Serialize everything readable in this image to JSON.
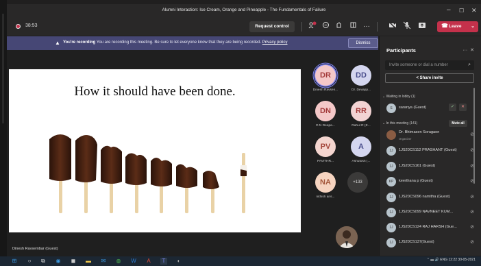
{
  "window": {
    "title": "Alumni Interaction: Ice Cream, Orange and Pineapple - The Fundamentals of Failure"
  },
  "toolbar": {
    "timer": "38:53",
    "request_control": "Request control",
    "leave": "Leave"
  },
  "banner": {
    "bold": "You're recording",
    "text": "You are recording this meeting. Be sure to let everyone know that they are being recorded.",
    "link": "Privacy policy",
    "dismiss": "Dismiss"
  },
  "slide": {
    "title": "How it should have been done.",
    "presenter": "Dinesh Ravsembar (Guest)"
  },
  "grid": {
    "tiles": [
      {
        "initials": "DR",
        "name": "Dinesh Ravsen...",
        "bg": "#f4c8c8",
        "fg": "#a33a3a",
        "active": true
      },
      {
        "initials": "DD",
        "name": "Dr. Devapp...",
        "bg": "#d4d6ef",
        "fg": "#4a4e8c",
        "active": false
      },
      {
        "initials": "DN",
        "name": "D N Deepa...",
        "bg": "#f4c8c8",
        "fg": "#a33a3a",
        "active": false
      },
      {
        "initials": "RR",
        "name": "Rahul R (E...",
        "bg": "#f2d3d3",
        "fg": "#a33a3a",
        "active": false
      },
      {
        "initials": "PV",
        "name": "PAVITHR...",
        "bg": "#f4d5cf",
        "fg": "#a3453a",
        "active": false
      },
      {
        "initials": "A",
        "name": "Ashutosh (...",
        "bg": "#d4d6ef",
        "fg": "#4a4e8c",
        "active": false
      },
      {
        "initials": "NA",
        "name": "nithish ans...",
        "bg": "#f6d4c0",
        "fg": "#a3563a",
        "active": false
      }
    ],
    "more": "+133"
  },
  "panel": {
    "title": "Participants",
    "invite_placeholder": "Invite someone or dial a number",
    "share_invite": "Share invite",
    "lobby_header": "Waiting in lobby (1)",
    "lobby": [
      {
        "name": "saranya (Guest)",
        "initial": "S"
      }
    ],
    "meeting_header": "In this meeting (141)",
    "mute_all": "Mute all",
    "people": [
      {
        "name": "Dr. Bhimasen Soragaon",
        "role": "Organizer",
        "initial": "",
        "photo": true
      },
      {
        "name": "1JS20CS112 PRASHANT (Guest)",
        "role": "",
        "initial": "1J",
        "photo": false
      },
      {
        "name": "1JS20CS161 (Guest)",
        "role": "",
        "initial": "1J",
        "photo": false
      },
      {
        "name": "keerthana p (Guest)",
        "role": "",
        "initial": "KP",
        "photo": false
      },
      {
        "name": "1JS20CS096 namitha (Guest)",
        "role": "",
        "initial": "1J",
        "photo": false
      },
      {
        "name": "1JS20CS099 NAVNEET KUM...",
        "role": "",
        "initial": "1J",
        "photo": false
      },
      {
        "name": "1JS20CS124 RAJ HARSH (Gue...",
        "role": "",
        "initial": "1J",
        "photo": false
      },
      {
        "name": "1JS20CS137(Guest)",
        "role": "",
        "initial": "1J",
        "photo": false
      }
    ]
  },
  "colors": {
    "accent": "#464775",
    "leave": "#c4314b",
    "bg": "#201f1f"
  },
  "tray": {
    "lang": "ENG",
    "time": "12:22",
    "date": "30-05-2021"
  }
}
